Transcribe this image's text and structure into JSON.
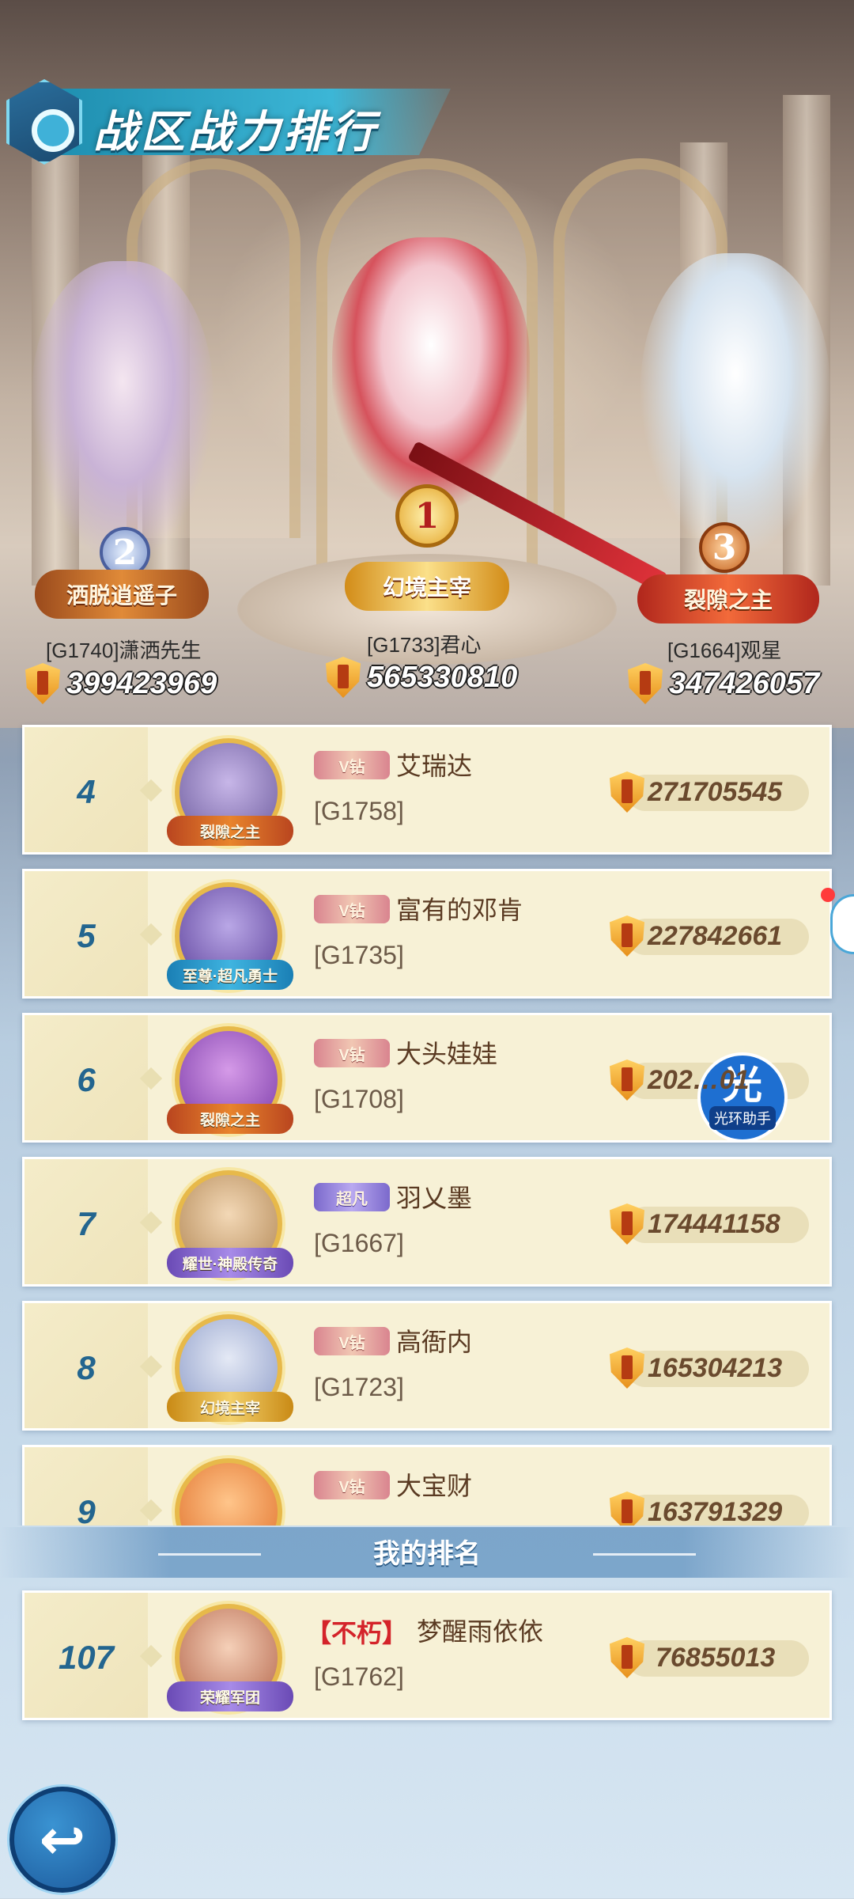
{
  "header": {
    "title": "战区战力排行"
  },
  "podium": [
    {
      "rank": "2",
      "title": "洒脱逍遥子",
      "name": "[G1740]潇洒先生",
      "power": "399423969"
    },
    {
      "rank": "1",
      "title": "幻境主宰",
      "name": "[G1733]君心",
      "power": "565330810"
    },
    {
      "rank": "3",
      "title": "裂隙之主",
      "name": "[G1664]观星",
      "power": "347426057"
    }
  ],
  "list": [
    {
      "rank": "4",
      "badge": "裂隙之主",
      "vip": "V钻",
      "name": "艾瑞达",
      "server": "[G1758]",
      "power": "271705545"
    },
    {
      "rank": "5",
      "badge": "至尊·超凡勇士",
      "vip": "V钻",
      "name": "富有的邓肯",
      "server": "[G1735]",
      "power": "227842661"
    },
    {
      "rank": "6",
      "badge": "裂隙之主",
      "vip": "V钻",
      "name": "大头娃娃",
      "server": "[G1708]",
      "power": "202…01"
    },
    {
      "rank": "7",
      "badge": "耀世·神殿传奇",
      "vip": "超凡",
      "name": "羽乂墨",
      "server": "[G1667]",
      "power": "174441158"
    },
    {
      "rank": "8",
      "badge": "幻境主宰",
      "vip": "V钻",
      "name": "高衙内",
      "server": "[G1723]",
      "power": "165304213"
    },
    {
      "rank": "9",
      "badge": "",
      "vip": "V钻",
      "name": "大宝财",
      "server": "",
      "power": "163791329"
    }
  ],
  "my_rank": {
    "section_title": "我的排名",
    "rank": "107",
    "badge": "荣耀军团",
    "tag": "【不朽】",
    "name": "梦醒雨依依",
    "server": "[G1762]",
    "power": "76855013"
  },
  "assistant": {
    "glyph": "光",
    "label": "光环助手"
  },
  "colors": {
    "accent": "#23658f",
    "card": "#f7f1d6",
    "banner": "#2fa7cb"
  }
}
